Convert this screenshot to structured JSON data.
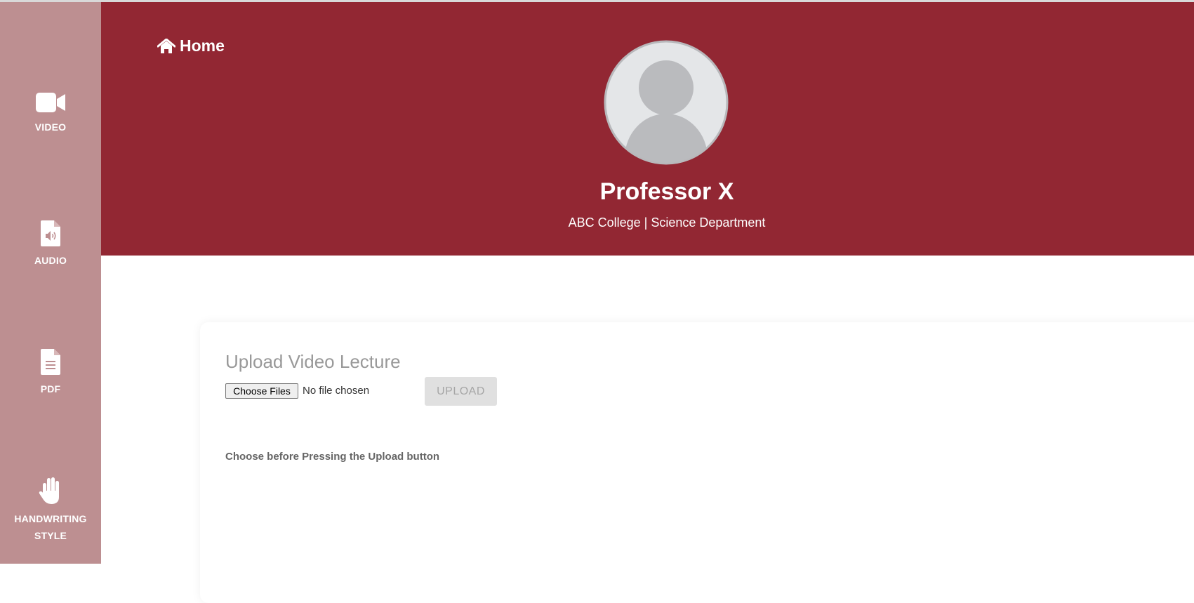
{
  "sidebar": {
    "items": [
      {
        "label": "VIDEO",
        "icon": "video-camera-icon"
      },
      {
        "label": "AUDIO",
        "icon": "audio-file-icon"
      },
      {
        "label": "PDF",
        "icon": "document-file-icon"
      },
      {
        "label": "HANDWRITING STYLE",
        "icon": "hand-icon"
      }
    ]
  },
  "header": {
    "home_label": "Home",
    "home_icon": "home-icon",
    "profile_name": "Professor X",
    "profile_subtitle": "ABC College | Science Department",
    "avatar_icon": "user-avatar-icon"
  },
  "upload": {
    "title": "Upload Video Lecture",
    "choose_label": "Choose Files",
    "file_status": "No file chosen",
    "upload_label": "UPLOAD",
    "hint": "Choose before Pressing the Upload button"
  },
  "colors": {
    "header_bg": "#922733",
    "sidebar_bg": "#bd8f91",
    "upload_disabled_bg": "#e0e0e0",
    "title_gray": "#999999"
  }
}
